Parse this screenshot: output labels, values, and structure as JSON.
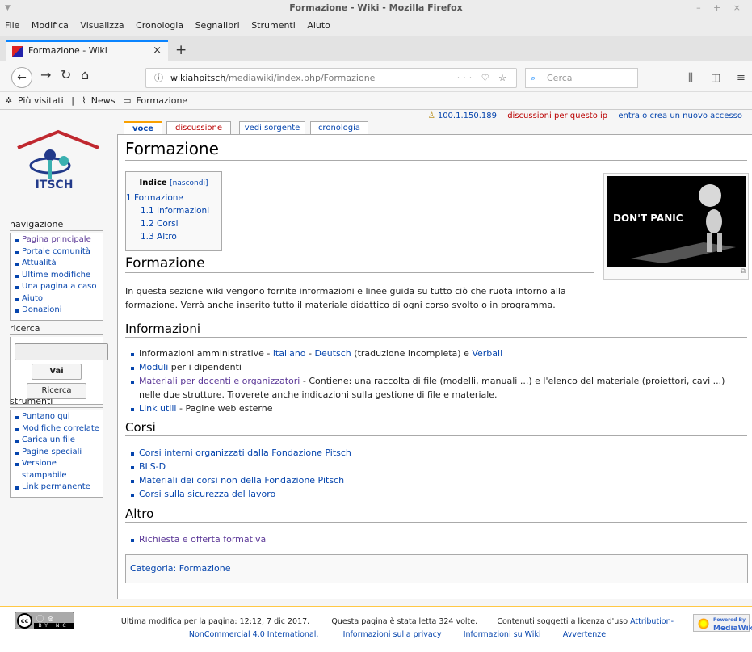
{
  "window": {
    "title": "Formazione - Wiki - Mozilla Firefox",
    "controls": "– + ×",
    "menu_icon": "▼"
  },
  "menubar": [
    "File",
    "Modifica",
    "Visualizza",
    "Cronologia",
    "Segnalibri",
    "Strumenti",
    "Aiuto"
  ],
  "tab": {
    "label": "Formazione - Wiki",
    "close": "×",
    "new_tab": "+"
  },
  "navbar": {
    "url_host": "wikiahpitsch",
    "url_rest": "/mediawiki/index.php/Formazione",
    "url_actions": "··· ♡ ☆",
    "search_placeholder": "Cerca"
  },
  "bookmarks": [
    "Più visitati",
    "|",
    "News",
    "Formazione"
  ],
  "personal": {
    "ip": "100.1.150.189",
    "talk": "discussioni per questo ip",
    "login": "entra o crea un nuovo accesso"
  },
  "content_tabs": [
    "voce",
    "discussione",
    "vedi sorgente",
    "cronologia"
  ],
  "logo_text": "ITSCH",
  "navigation": {
    "heading": "navigazione",
    "items": [
      "Pagina principale",
      "Portale comunità",
      "Attualità",
      "Ultime modifiche",
      "Una pagina a caso",
      "Aiuto",
      "Donazioni"
    ]
  },
  "search": {
    "heading": "ricerca",
    "go": "Vai",
    "search": "Ricerca"
  },
  "tools": {
    "heading": "strumenti",
    "items": [
      "Puntano qui",
      "Modifiche correlate",
      "Carica un file",
      "Pagine speciali",
      "Versione stampabile",
      "Link permanente"
    ]
  },
  "page": {
    "title": "Formazione",
    "toc": {
      "title": "Indice",
      "toggle": "[nascondi]",
      "items": [
        "1 Formazione",
        "1.1 Informazioni",
        "1.2 Corsi",
        "1.3 Altro"
      ]
    },
    "thumb_text": "DON'T PANIC",
    "h2": "Formazione",
    "intro": "In questa sezione wiki vengono fornite informazioni e linee guida su tutto ciò che ruota intorno alla formazione. Verrà anche inserito tutto il materiale didattico di ogni corso svolto o in programma.",
    "informazioni": {
      "heading": "Informazioni",
      "item1": {
        "pre": "Informazioni amministrative - ",
        "l1": "italiano",
        "sep": " - ",
        "l2": "Deutsch",
        "mid": " (traduzione incompleta) e ",
        "l3": "Verbali"
      },
      "item2": {
        "link": "Moduli",
        "text": " per i dipendenti"
      },
      "item3": {
        "link": "Materiali per docenti e organizzatori",
        "text": " - Contiene: una raccolta di file (modelli, manuali ...) e l'elenco del materiale (proiettori, cavi ...) nelle due strutture. Troverete anche indicazioni sulla gestione di file e materiale."
      },
      "item4": {
        "link": "Link utili",
        "text": " - Pagine web esterne"
      }
    },
    "corsi": {
      "heading": "Corsi",
      "items": [
        "Corsi interni organizzati dalla Fondazione Pitsch",
        "BLS-D",
        "Materiali dei corsi non della Fondazione Pitsch",
        "Corsi sulla sicurezza del lavoro"
      ]
    },
    "altro": {
      "heading": "Altro",
      "items": [
        "Richiesta e offerta formativa"
      ]
    },
    "category": "Categoria: Formazione"
  },
  "footer": {
    "last_mod": "Ultima modifica per la pagina: 12:12, 7 dic 2017.",
    "views": "Questa pagina è stata letta 324 volte.",
    "license_pre": "Contenuti soggetti a licenza d'uso ",
    "license_link1": "Attribution-",
    "license_link2": "NonCommercial 4.0 International.",
    "privacy": "Informazioni sulla privacy",
    "about": "Informazioni su Wiki",
    "disclaimer": "Avvertenze",
    "cc_text": "BY NC",
    "mw_small": "Powered By",
    "mw": "MediaWiki"
  }
}
